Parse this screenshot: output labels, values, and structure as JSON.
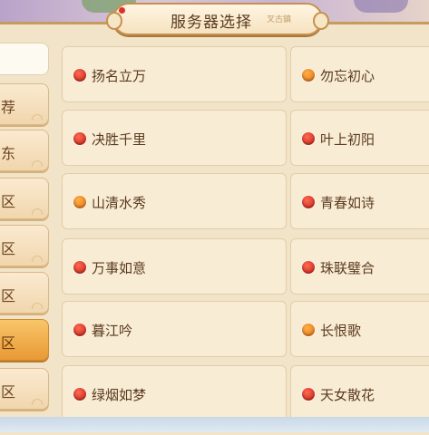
{
  "title": "服务器选择",
  "title_sub": "叉古鎮",
  "tabs": [
    {
      "label": "",
      "state": "blank"
    },
    {
      "label": "荐",
      "state": "normal"
    },
    {
      "label": "东",
      "state": "normal"
    },
    {
      "label": "区",
      "state": "normal"
    },
    {
      "label": "区",
      "state": "normal"
    },
    {
      "label": "区",
      "state": "normal"
    },
    {
      "label": "区",
      "state": "active"
    },
    {
      "label": "区",
      "state": "normal"
    }
  ],
  "servers_left": [
    {
      "name": "扬名立万",
      "status": "red"
    },
    {
      "name": "决胜千里",
      "status": "red"
    },
    {
      "name": "山清水秀",
      "status": "orange"
    },
    {
      "name": "万事如意",
      "status": "red"
    },
    {
      "name": "暮江吟",
      "status": "red"
    },
    {
      "name": "绿烟如梦",
      "status": "red"
    }
  ],
  "servers_right": [
    {
      "name": "勿忘初心",
      "status": "orange"
    },
    {
      "name": "叶上初阳",
      "status": "red"
    },
    {
      "name": "青春如诗",
      "status": "red"
    },
    {
      "name": "珠联璧合",
      "status": "red"
    },
    {
      "name": "长恨歌",
      "status": "orange"
    },
    {
      "name": "天女散花",
      "status": "red"
    }
  ],
  "colors": {
    "red": "#d8342a",
    "orange": "#ef8a1e",
    "panel": "#f2e4c8",
    "accent": "#e89a34"
  }
}
